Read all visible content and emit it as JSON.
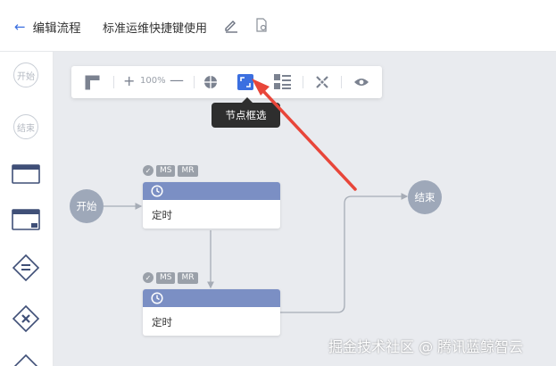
{
  "header": {
    "back_label": "编辑流程",
    "flow_name": "标准运维快捷键使用"
  },
  "palette": {
    "start_label": "开始",
    "end_label": "结束"
  },
  "toolbar": {
    "zoom_level": "100%",
    "tooltip": "节点框选"
  },
  "flow": {
    "start_label": "开始",
    "end_label": "结束",
    "tasks": [
      {
        "label": "定时",
        "badges": [
          "MS",
          "MR"
        ]
      },
      {
        "label": "定时",
        "badges": [
          "MS",
          "MR"
        ]
      }
    ]
  },
  "watermark": "掘金技术社区 @ 腾讯蓝鲸智云",
  "colors": {
    "accent": "#3b6fe0",
    "task_header": "#7b8fc4",
    "node_gray": "#9ea8b9",
    "canvas_bg": "#e9ebef",
    "arrow_red": "#e8463a"
  }
}
